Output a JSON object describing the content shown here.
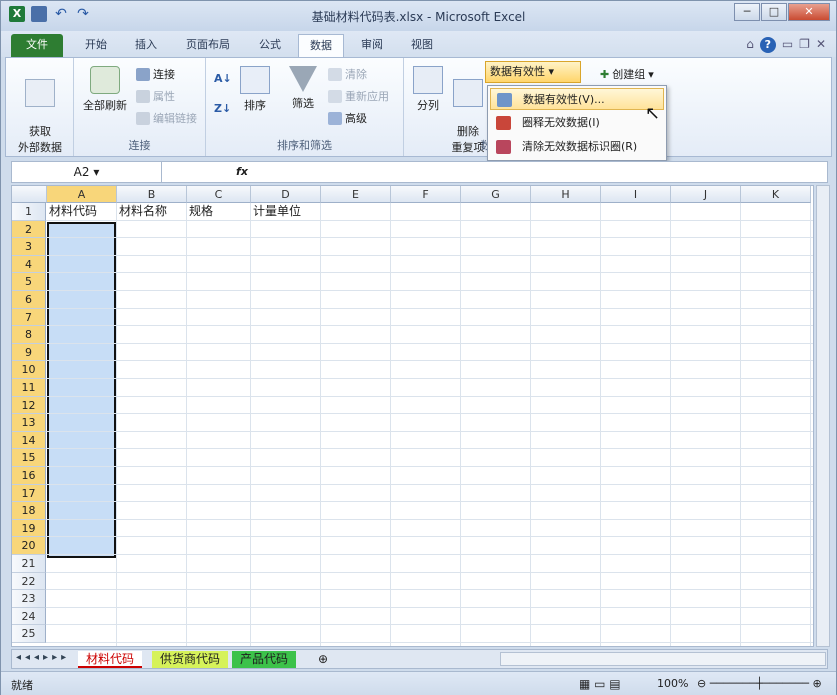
{
  "window": {
    "title": "基础材料代码表.xlsx - Microsoft Excel"
  },
  "tabs": [
    {
      "label": "文件"
    },
    {
      "label": "开始"
    },
    {
      "label": "插入"
    },
    {
      "label": "页面布局"
    },
    {
      "label": "公式"
    },
    {
      "label": "数据"
    },
    {
      "label": "审阅"
    },
    {
      "label": "视图"
    }
  ],
  "ribbon": {
    "get_external_data": "获取\n外部数据",
    "refresh_all": "全部刷新",
    "connections": "连接",
    "properties": "属性",
    "edit_links": "编辑链接",
    "group_connections": "连接",
    "sort": "排序",
    "filter": "筛选",
    "clear": "清除",
    "reapply": "重新应用",
    "advanced": "高级",
    "group_sort_filter": "排序和筛选",
    "text_to_columns": "分列",
    "remove_duplicates": "删除\n重复项",
    "data_validation": "数据有效性",
    "group_data_tools": "数",
    "group_outline": "创建组"
  },
  "menu": {
    "items": [
      {
        "label": "数据有效性(V)..."
      },
      {
        "label": "圈释无效数据(I)"
      },
      {
        "label": "清除无效数据标识圈(R)"
      }
    ]
  },
  "formula_bar": {
    "name_box": "A2",
    "fx": "fx",
    "value": ""
  },
  "columns": [
    "A",
    "B",
    "C",
    "D",
    "E",
    "F",
    "G",
    "H",
    "I",
    "J",
    "K"
  ],
  "rows": [
    "1",
    "2",
    "3",
    "4",
    "5",
    "6",
    "7",
    "8",
    "9",
    "10",
    "11",
    "12",
    "13",
    "14",
    "15",
    "16",
    "17",
    "18",
    "19",
    "20",
    "21",
    "22",
    "23",
    "24",
    "25"
  ],
  "row1": [
    "材料代码",
    "材料名称",
    "规格",
    "计量单位"
  ],
  "sheets": [
    {
      "label": "材料代码"
    },
    {
      "label": "供货商代码"
    },
    {
      "label": "产品代码"
    }
  ],
  "status": {
    "ready": "就绪",
    "zoom": "100%"
  },
  "colors": {
    "selection_fill": "#c7ddf6",
    "header_highlight": "#f8d67a"
  }
}
